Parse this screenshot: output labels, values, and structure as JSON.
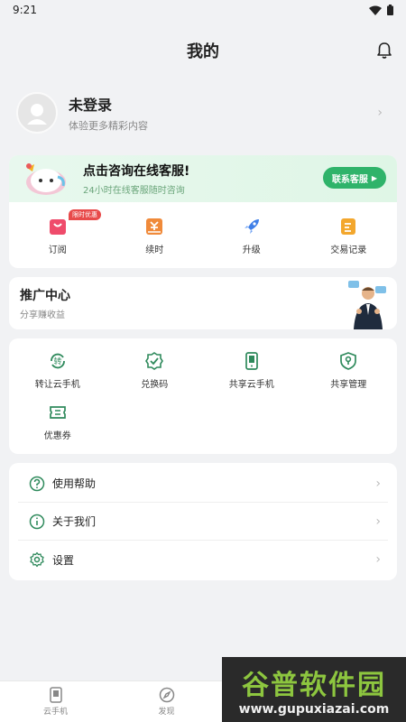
{
  "status_bar": {
    "time": "9:21"
  },
  "header": {
    "title": "我的"
  },
  "profile": {
    "name": "未登录",
    "subtitle": "体验更多精彩内容"
  },
  "customer_service": {
    "title": "点击咨询在线客服!",
    "subtitle": "24小时在线客服随时咨询",
    "button_label": "联系客服"
  },
  "quick_actions": [
    {
      "label": "订阅",
      "icon": "bag-icon",
      "badge": "限时优惠"
    },
    {
      "label": "续时",
      "icon": "renew-icon"
    },
    {
      "label": "升级",
      "icon": "rocket-icon"
    },
    {
      "label": "交易记录",
      "icon": "record-icon"
    }
  ],
  "promo": {
    "title": "推广中心",
    "subtitle": "分享赚收益"
  },
  "tools": [
    {
      "label": "转让云手机",
      "icon": "transfer-icon",
      "glyph": "转"
    },
    {
      "label": "兑换码",
      "icon": "redeem-icon"
    },
    {
      "label": "共享云手机",
      "icon": "phone-icon"
    },
    {
      "label": "共享管理",
      "icon": "shield-icon"
    },
    {
      "label": "优惠券",
      "icon": "coupon-icon"
    }
  ],
  "menu": [
    {
      "label": "使用帮助",
      "icon": "help-icon"
    },
    {
      "label": "关于我们",
      "icon": "info-icon"
    },
    {
      "label": "设置",
      "icon": "gear-icon"
    }
  ],
  "tabbar": [
    {
      "label": "云手机",
      "icon": "cloud-phone-icon"
    },
    {
      "label": "发现",
      "icon": "compass-icon"
    }
  ],
  "watermark": {
    "line1": "谷普软件园",
    "line2": "www.gupuxiazai.com"
  },
  "colors": {
    "accent": "#2fb36a",
    "background": "#f1f2f4",
    "badge": "#e84a4a"
  }
}
